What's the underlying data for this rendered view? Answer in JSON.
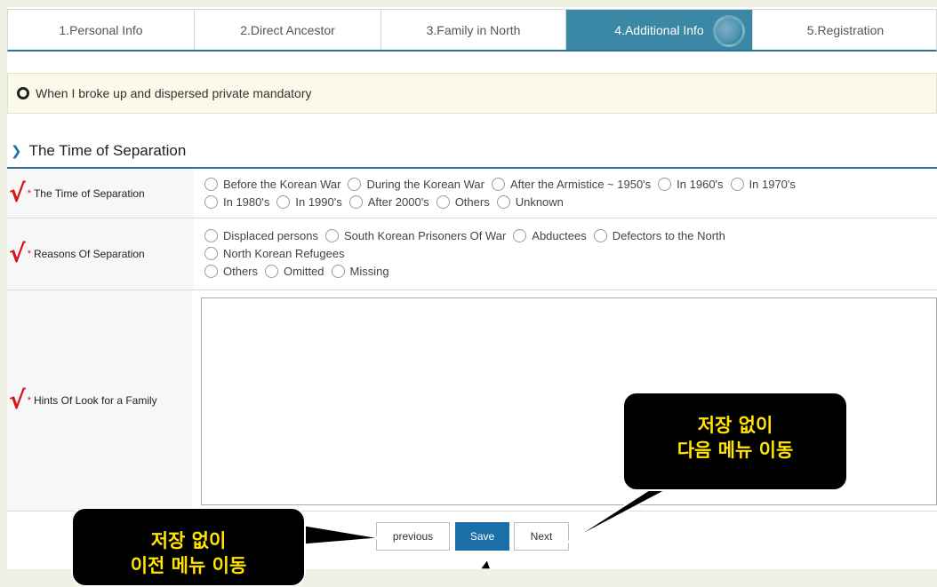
{
  "steps": [
    {
      "label": "1.Personal Info",
      "active": false
    },
    {
      "label": "2.Direct Ancestor",
      "active": false
    },
    {
      "label": "3.Family in North",
      "active": false
    },
    {
      "label": "4.Additional Info",
      "active": true
    },
    {
      "label": "5.Registration",
      "active": false
    }
  ],
  "notice": {
    "text": "When I broke up and dispersed private mandatory"
  },
  "section": {
    "title": "The Time of Separation"
  },
  "form": {
    "time": {
      "label": "The Time of Separation",
      "options_line1": [
        "Before the Korean War",
        "During the Korean War",
        "After the Armistice ~ 1950's",
        "In 1960's",
        "In 1970's"
      ],
      "options_line2": [
        "In 1980's",
        "In 1990's",
        "After 2000's",
        "Others",
        "Unknown"
      ]
    },
    "reasons": {
      "label": "Reasons Of Separation",
      "options_line1": [
        "Displaced persons",
        "South Korean Prisoners Of War",
        "Abductees",
        "Defectors to the North"
      ],
      "options_line2": [
        "North Korean Refugees"
      ],
      "options_line3": [
        "Others",
        "Omitted",
        "Missing"
      ]
    },
    "hints": {
      "label": "Hints Of Look for a Family",
      "value": ""
    }
  },
  "buttons": {
    "previous": "previous",
    "save": "Save",
    "next": "Next"
  },
  "callouts": {
    "next_line1": "저장 없이",
    "next_line2": "다음 메뉴 이동",
    "prev_line1": "저장 없이",
    "prev_line2": "이전 메뉴 이동"
  },
  "colors": {
    "accent": "#3a87a6",
    "required": "#d4161c",
    "callout_text": "#ffe400",
    "save": "#1b6fa8"
  }
}
